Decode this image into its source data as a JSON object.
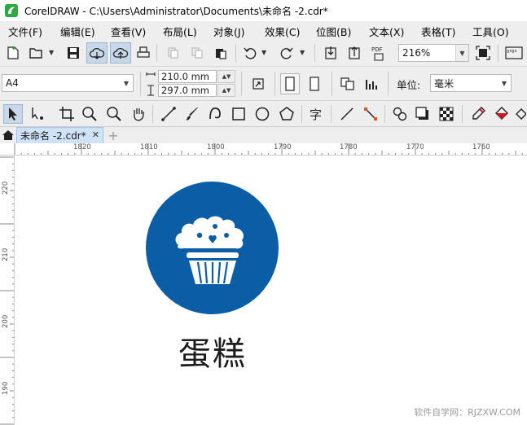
{
  "window": {
    "title": "CorelDRAW - C:\\Users\\Administrator\\Documents\\未命名 -2.cdr*"
  },
  "menubar": {
    "items": [
      {
        "label": "文件(F)"
      },
      {
        "label": "编辑(E)"
      },
      {
        "label": "查看(V)"
      },
      {
        "label": "布局(L)"
      },
      {
        "label": "对象(J)"
      },
      {
        "label": "效果(C)"
      },
      {
        "label": "位图(B)"
      },
      {
        "label": "文本(X)"
      },
      {
        "label": "表格(T)"
      },
      {
        "label": "工具(O)"
      }
    ]
  },
  "toolbar": {
    "zoom_value": "216%"
  },
  "property_bar": {
    "page_size": "A4",
    "width": "210.0 mm",
    "height": "297.0 mm",
    "units_label": "单位:",
    "units_value": "毫米"
  },
  "document_tabs": {
    "active_tab": "未命名 -2.cdr*",
    "add_tab_symbol": "+"
  },
  "rulers": {
    "horizontal_labels": [
      "1820",
      "1810",
      "1800",
      "1790",
      "1780",
      "1770",
      "1760"
    ],
    "vertical_labels": [
      "220",
      "210",
      "200",
      "190"
    ]
  },
  "canvas": {
    "caption": "蛋糕",
    "circle_color": "#0b5ea5",
    "icon": "cupcake-icon"
  },
  "watermark": "软件自学网：RJZXW.COM",
  "colors": {
    "accent": "#0b5ea5",
    "tab_active": "#cfe2f7",
    "chrome": "#eeeeee"
  }
}
